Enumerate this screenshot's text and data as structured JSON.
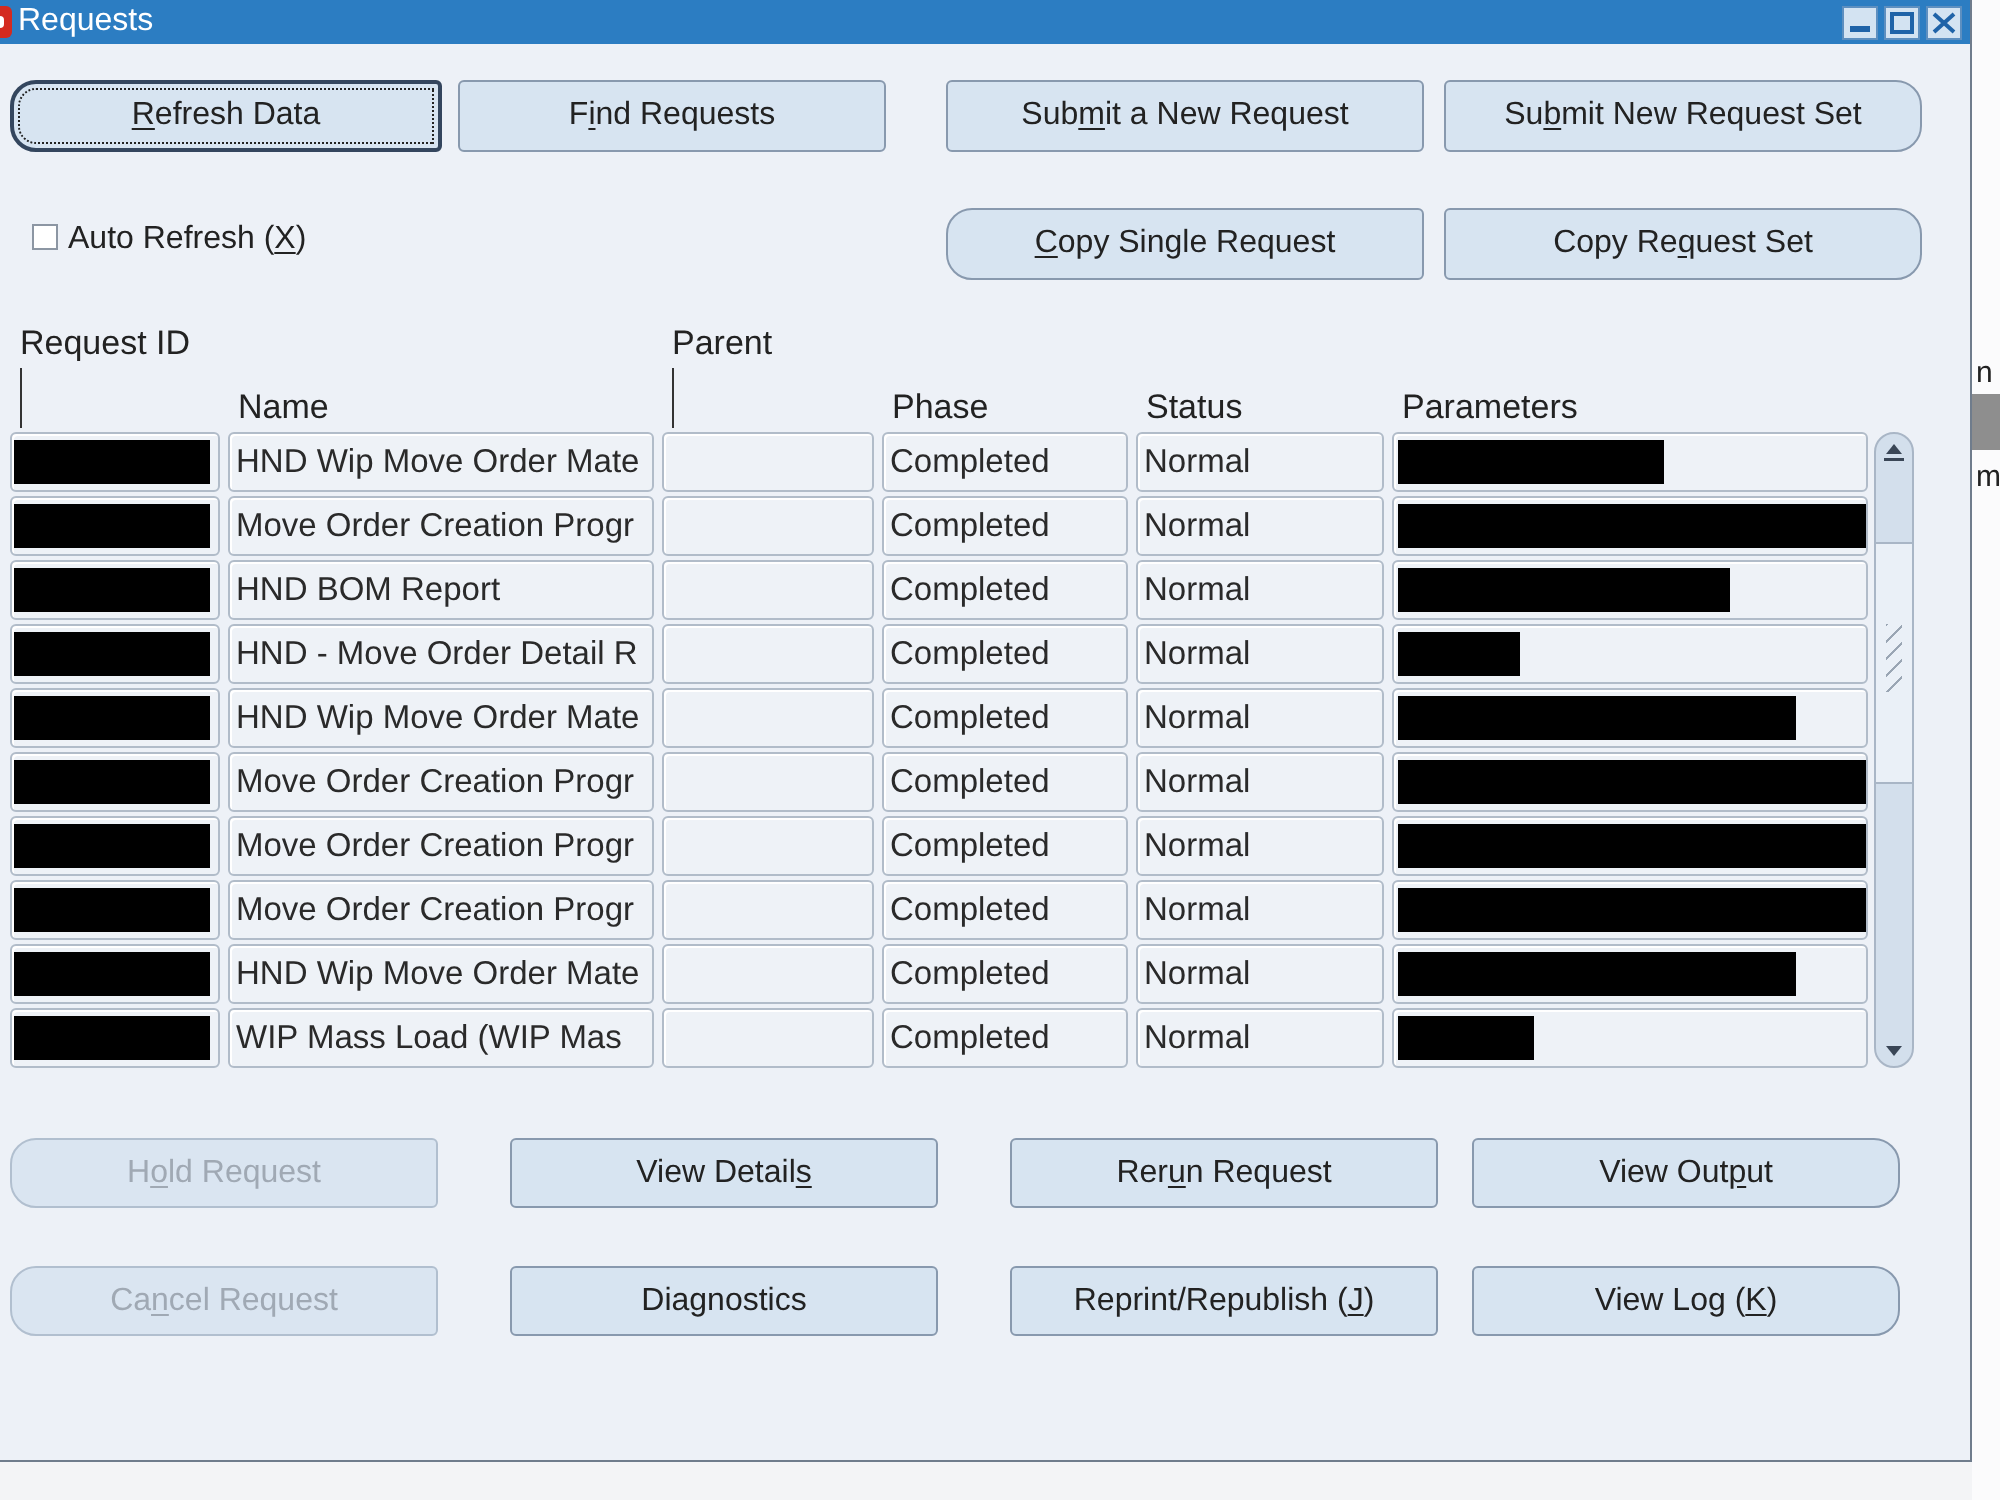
{
  "window": {
    "title": "Requests"
  },
  "buttons_row_1": [
    {
      "label": [
        {
          "text": "R",
          "underlined": true
        },
        {
          "text": "efresh Data",
          "underlined": false
        }
      ],
      "focused": true,
      "disabled": false
    },
    {
      "label": [
        {
          "text": "F",
          "underlined": false
        },
        {
          "text": "i",
          "underlined": true
        },
        {
          "text": "nd Requests",
          "underlined": false
        }
      ],
      "focused": false,
      "disabled": false
    },
    {
      "label": [
        {
          "text": "Sub",
          "underlined": false
        },
        {
          "text": "m",
          "underlined": true
        },
        {
          "text": "it a New Request",
          "underlined": false
        }
      ],
      "focused": false,
      "disabled": false
    },
    {
      "label": [
        {
          "text": "Su",
          "underlined": false
        },
        {
          "text": "b",
          "underlined": true
        },
        {
          "text": "mit New Request Set",
          "underlined": false
        }
      ],
      "focused": false,
      "disabled": false
    }
  ],
  "auto_refresh": {
    "label": [
      {
        "text": "Auto Refresh (",
        "underlined": false
      },
      {
        "text": "X",
        "underlined": true
      },
      {
        "text": ")",
        "underlined": false
      }
    ],
    "checked": false
  },
  "buttons_row_2": [
    {
      "label": [
        {
          "text": "C",
          "underlined": true
        },
        {
          "text": "opy Single Request",
          "underlined": false
        }
      ],
      "focused": false,
      "disabled": false
    },
    {
      "label": [
        {
          "text": "Copy Re",
          "underlined": false
        },
        {
          "text": "q",
          "underlined": true
        },
        {
          "text": "uest Set",
          "underlined": false
        }
      ],
      "focused": false,
      "disabled": false
    }
  ],
  "table": {
    "columns": [
      {
        "label": "Request ID",
        "kind": "upper"
      },
      {
        "label": "Name",
        "kind": "lower"
      },
      {
        "label": "Parent",
        "kind": "upper"
      },
      {
        "label": "Phase",
        "kind": "lower"
      },
      {
        "label": "Status",
        "kind": "lower"
      },
      {
        "label": "Parameters",
        "kind": "lower"
      }
    ],
    "rows": [
      {
        "request_id_redacted": true,
        "name": "HND Wip Move Order Mate",
        "phase": "Completed",
        "status": "Normal",
        "parameters_redaction": {
          "level": 0.57
        }
      },
      {
        "request_id_redacted": true,
        "name": "Move Order Creation Progr",
        "phase": "Completed",
        "status": "Normal",
        "parameters_redaction": {
          "level": 1
        }
      },
      {
        "request_id_redacted": true,
        "name": "HND BOM Report",
        "phase": "Completed",
        "status": "Normal",
        "parameters_redaction": {
          "level": 0.71
        }
      },
      {
        "request_id_redacted": true,
        "name": "HND - Move Order Detail R",
        "phase": "Completed",
        "status": "Normal",
        "parameters_redaction": {
          "level": 0.26
        }
      },
      {
        "request_id_redacted": true,
        "name": "HND Wip Move Order Mate",
        "phase": "Completed",
        "status": "Normal",
        "parameters_redaction": {
          "level": 0.85
        }
      },
      {
        "request_id_redacted": true,
        "name": "Move Order Creation Progr",
        "phase": "Completed",
        "status": "Normal",
        "parameters_redaction": {
          "level": 1
        }
      },
      {
        "request_id_redacted": true,
        "name": "Move Order Creation Progr",
        "phase": "Completed",
        "status": "Normal",
        "parameters_redaction": {
          "level": 1
        }
      },
      {
        "request_id_redacted": true,
        "name": "Move Order Creation Progr",
        "phase": "Completed",
        "status": "Normal",
        "parameters_redaction": {
          "level": 1
        }
      },
      {
        "request_id_redacted": true,
        "name": "HND Wip Move Order Mate",
        "phase": "Completed",
        "status": "Normal",
        "parameters_redaction": {
          "level": 0.85
        }
      },
      {
        "request_id_redacted": true,
        "name": "WIP Mass Load (WIP Mas",
        "phase": "Completed",
        "status": "Normal",
        "parameters_redaction": {
          "level": 0.29
        }
      }
    ]
  },
  "action_rows": [
    [
      {
        "label": [
          {
            "text": "H",
            "underlined": false
          },
          {
            "text": "o",
            "underlined": true
          },
          {
            "text": "ld Request",
            "underlined": false
          }
        ],
        "focused": false,
        "disabled": true
      },
      {
        "label": [
          {
            "text": "View Detail",
            "underlined": false
          },
          {
            "text": "s",
            "underlined": true
          }
        ],
        "focused": false,
        "disabled": false
      },
      {
        "label": [
          {
            "text": "Rer",
            "underlined": false
          },
          {
            "text": "u",
            "underlined": true
          },
          {
            "text": "n Request",
            "underlined": false
          }
        ],
        "focused": false,
        "disabled": false
      },
      {
        "label": [
          {
            "text": "View Out",
            "underlined": false
          },
          {
            "text": "p",
            "underlined": true
          },
          {
            "text": "ut",
            "underlined": false
          }
        ],
        "focused": false,
        "disabled": false
      }
    ],
    [
      {
        "label": [
          {
            "text": "Ca",
            "underlined": false
          },
          {
            "text": "n",
            "underlined": true
          },
          {
            "text": "cel Request",
            "underlined": false
          }
        ],
        "focused": false,
        "disabled": true
      },
      {
        "label": [
          {
            "text": "Diagnostics",
            "underlined": false
          }
        ],
        "focused": false,
        "disabled": false
      },
      {
        "label": [
          {
            "text": "Reprint/Republish (",
            "underlined": false
          },
          {
            "text": "J",
            "underlined": true
          },
          {
            "text": ")",
            "underlined": false
          }
        ],
        "focused": false,
        "disabled": false
      },
      {
        "label": [
          {
            "text": "View Log (",
            "underlined": false
          },
          {
            "text": "K",
            "underlined": true
          },
          {
            "text": ")",
            "underlined": false
          }
        ],
        "focused": false,
        "disabled": false
      }
    ]
  ],
  "background_window": {
    "items": [
      {
        "kind": "text",
        "text": "n"
      },
      {
        "kind": "block"
      },
      {
        "kind": "text",
        "text": "m"
      }
    ]
  }
}
